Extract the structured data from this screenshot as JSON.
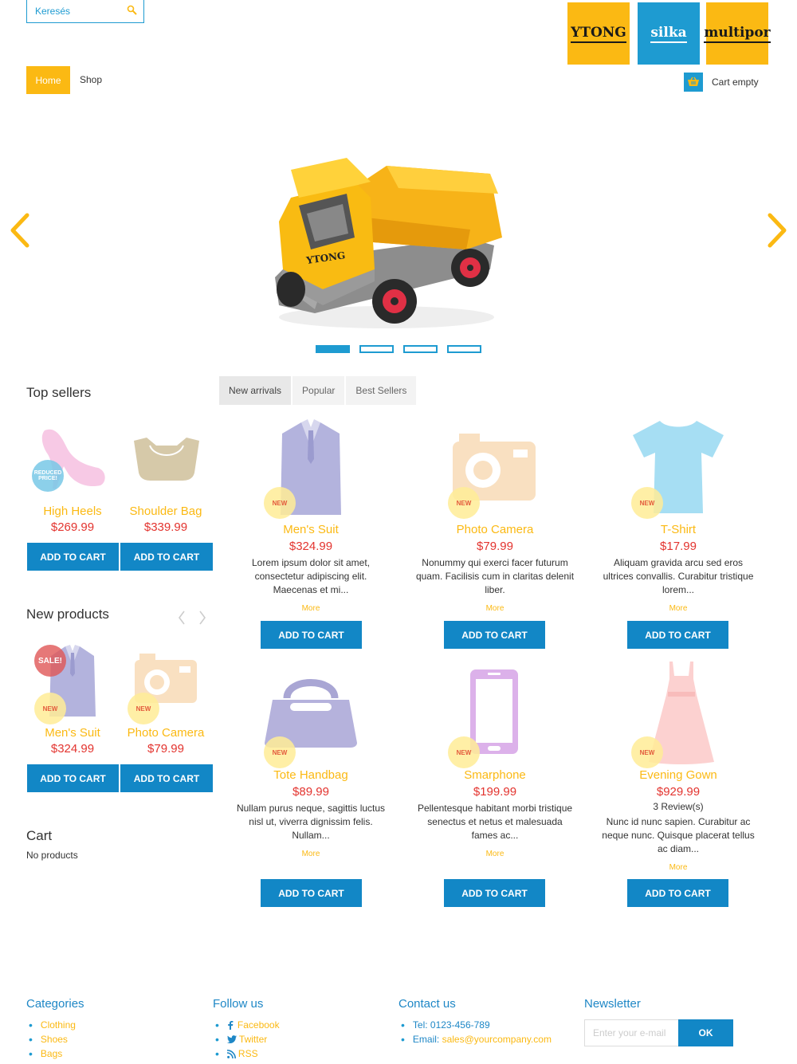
{
  "search": {
    "placeholder": "Keresés"
  },
  "brands": [
    "YTONG",
    "silka",
    "multipor"
  ],
  "nav": {
    "home": "Home",
    "shop": "Shop"
  },
  "cart_header": {
    "label": "Cart empty"
  },
  "slider": {
    "brand_on_truck": "YTONG",
    "active_slide": 1,
    "slide_count": 4
  },
  "top_sellers": {
    "title": "Top sellers",
    "products": [
      {
        "name": "High Heels",
        "price": "$269.99",
        "badge": "REDUCED PRICE!",
        "button": "ADD TO CART"
      },
      {
        "name": "Shoulder Bag",
        "price": "$339.99",
        "button": "ADD TO CART"
      }
    ]
  },
  "new_products": {
    "title": "New products",
    "products": [
      {
        "name": "Men's Suit",
        "price": "$324.99",
        "badges": [
          "SALE!",
          "NEW"
        ],
        "button": "ADD TO CART"
      },
      {
        "name": "Photo Camera",
        "price": "$79.99",
        "badges": [
          "NEW"
        ],
        "button": "ADD TO CART"
      }
    ]
  },
  "cart_block": {
    "title": "Cart",
    "empty": "No products"
  },
  "tabs": [
    "New arrivals",
    "Popular",
    "Best Sellers"
  ],
  "products": [
    {
      "name": "Men's Suit",
      "price": "$324.99",
      "badge": "NEW",
      "desc": [
        "Lorem ipsum dolor sit amet,",
        "consectetur adipiscing elit.",
        "Maecenas et mi..."
      ],
      "more": "More",
      "button": "ADD TO CART"
    },
    {
      "name": "Photo Camera",
      "price": "$79.99",
      "badge": "NEW",
      "desc": [
        "Nonummy qui exerci facer futurum",
        "quam. Facilisis cum in claritas delenit",
        "liber."
      ],
      "more": "More",
      "button": "ADD TO CART"
    },
    {
      "name": "T-Shirt",
      "price": "$17.99",
      "badge": "NEW",
      "desc": [
        "Aliquam gravida arcu sed eros",
        "ultrices convallis. Curabitur tristique",
        "lorem..."
      ],
      "more": "More",
      "button": "ADD TO CART"
    },
    {
      "name": "Tote Handbag",
      "price": "$89.99",
      "badge": "NEW",
      "desc": [
        "Nullam purus neque, sagittis luctus",
        "nisl ut, viverra dignissim felis.",
        "Nullam..."
      ],
      "more": "More",
      "button": "ADD TO CART"
    },
    {
      "name": "Smarphone",
      "price": "$199.99",
      "badge": "NEW",
      "desc": [
        "Pellentesque habitant morbi tristique",
        "senectus et netus et malesuada",
        "fames ac..."
      ],
      "more": "More",
      "button": "ADD TO CART"
    },
    {
      "name": "Evening Gown",
      "price": "$929.99",
      "badge": "NEW",
      "reviews": "3 Review(s)",
      "desc": [
        "Nunc id nunc sapien. Curabitur ac",
        "neque nunc. Quisque placerat tellus",
        "ac diam..."
      ],
      "more": "More",
      "button": "ADD TO CART"
    }
  ],
  "footer": {
    "categories": {
      "title": "Categories",
      "items": [
        "Clothing",
        "Shoes",
        "Bags"
      ]
    },
    "follow": {
      "title": "Follow us",
      "items": [
        "Facebook",
        "Twitter",
        "RSS"
      ]
    },
    "contact": {
      "title": "Contact us",
      "tel": "Tel: 0123-456-789",
      "email_label": "Email: ",
      "email": "sales@yourcompany.com"
    },
    "newsletter": {
      "title": "Newsletter",
      "placeholder": "Enter your e-mail",
      "button": "OK"
    }
  },
  "colors": {
    "accent_yellow": "#fbb913",
    "accent_blue": "#1e9bd1",
    "button_blue": "#1287c6",
    "price_red": "#e3342f"
  }
}
